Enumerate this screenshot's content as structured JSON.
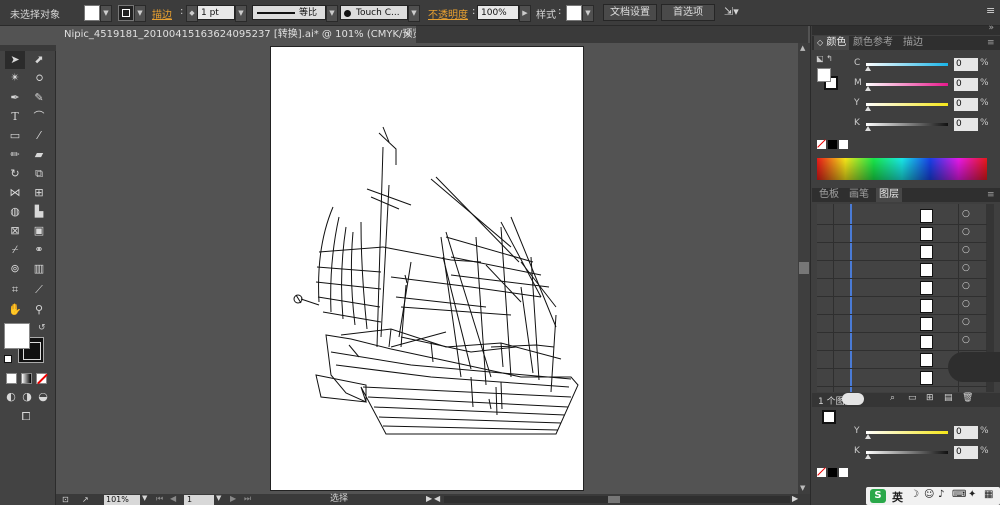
{
  "control_bar": {
    "selection_label": "未选择对象",
    "stroke_label": "描边",
    "stroke_weight": "1 pt",
    "stroke_profile_label": "等比",
    "brush_label": "Touch C...",
    "opacity_label": "不透明度",
    "opacity_value": "100%",
    "style_label": "样式",
    "doc_setup_button": "文档设置",
    "preferences_button": "首选项"
  },
  "document_tab": {
    "title": "Nipic_4519181_20100415163624095237 [转换].ai* @ 101% (CMYK/预览)",
    "close_glyph": "×"
  },
  "color_panel": {
    "tabs": [
      "颜色",
      "颜色参考",
      "描边"
    ],
    "channels": [
      {
        "letter": "C",
        "value": "0",
        "color": "#19b5e8"
      },
      {
        "letter": "M",
        "value": "0",
        "color": "#e8198c"
      },
      {
        "letter": "Y",
        "value": "0",
        "color": "#f5e619"
      },
      {
        "letter": "K",
        "value": "0",
        "color": "#111111"
      }
    ],
    "unit": "%"
  },
  "layers_panel": {
    "tabs": [
      "色板",
      "画笔",
      "图层"
    ],
    "status_text": "1 个图层"
  },
  "second_color_panel": {
    "channels": [
      {
        "letter": "Y",
        "value": "0",
        "color": "#f5e619"
      },
      {
        "letter": "K",
        "value": "0",
        "color": "#111111"
      }
    ],
    "unit": "%"
  },
  "status_bar": {
    "zoom": "101%",
    "page": "1",
    "mode": "选择"
  },
  "taskbar": {
    "ime_label": "英"
  },
  "colors": {
    "accent": "#e8a030",
    "panel_bg": "#3f3f3f",
    "canvas_bg": "#535353"
  }
}
